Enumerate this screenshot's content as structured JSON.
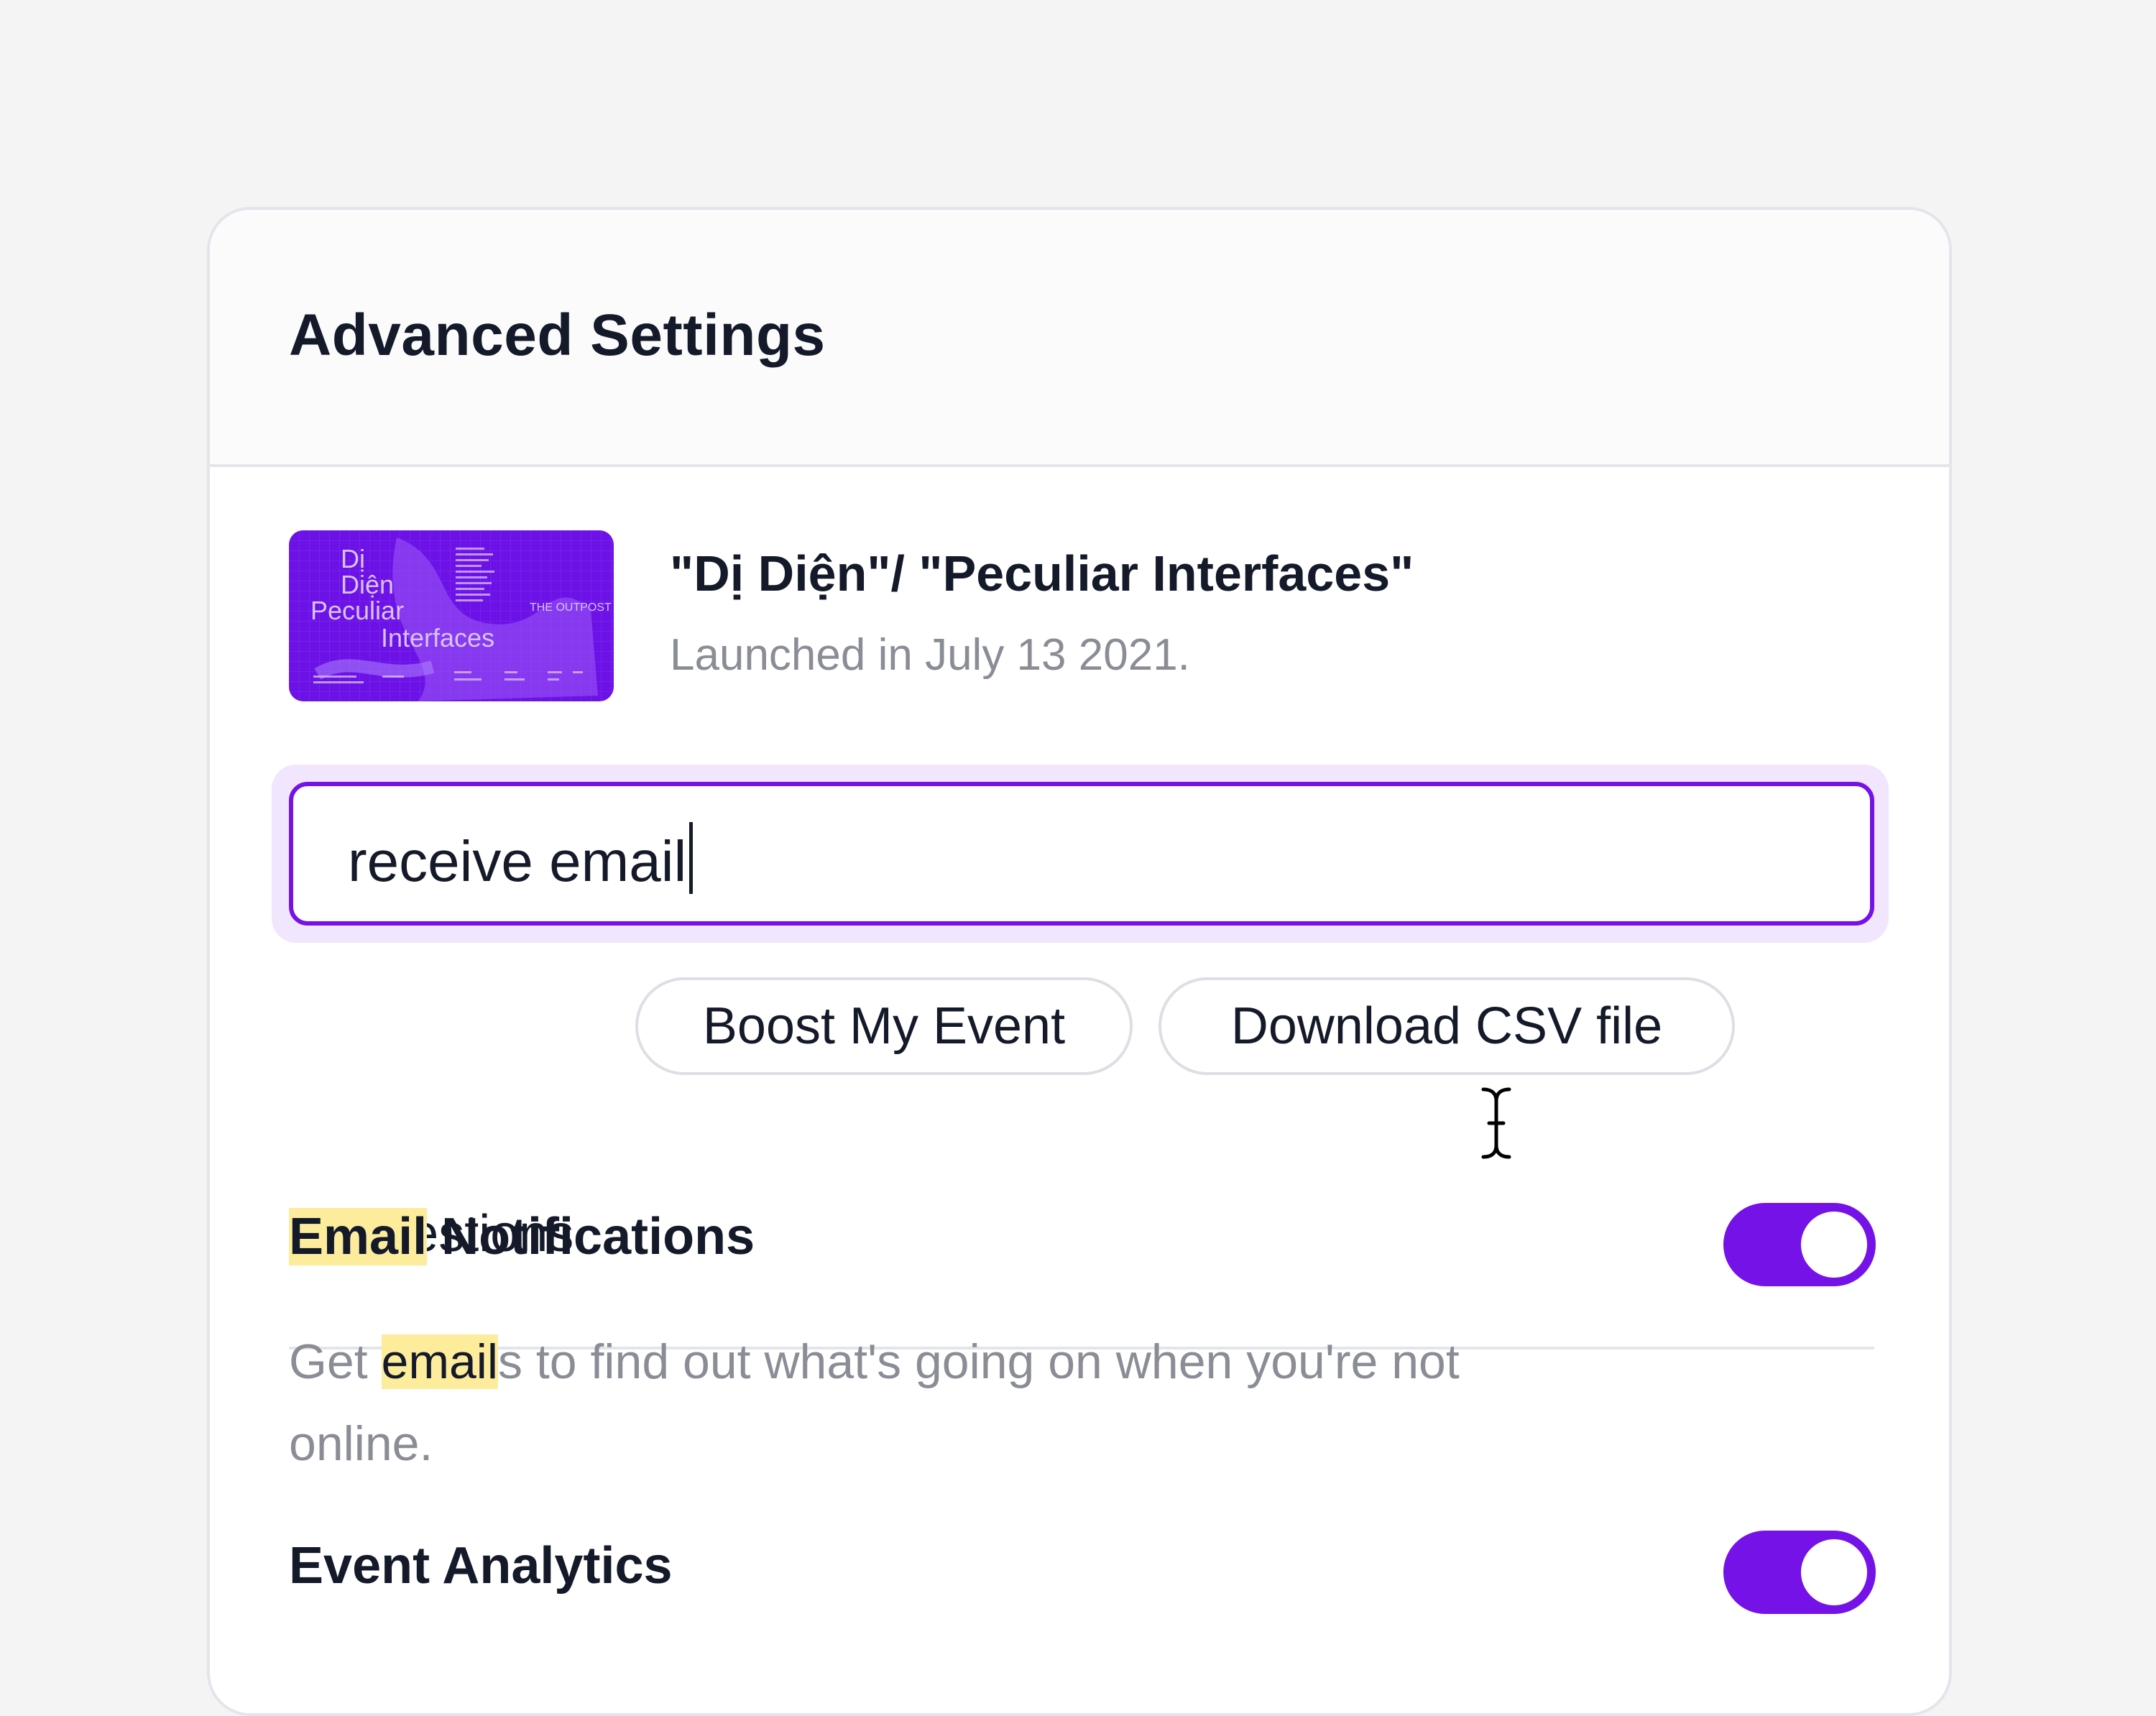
{
  "header": {
    "title": "Advanced Settings"
  },
  "event": {
    "title": "\"Dị Diện\"/ \"Peculiar Interfaces\"",
    "subtitle": "Launched in July 13 2021.",
    "thumbnail": {
      "line1": "Dị",
      "line2": "Diện",
      "line3": "Peculiar",
      "line4": "Interfaces",
      "venue": "THE OUTPOST"
    }
  },
  "search": {
    "value": "receive email"
  },
  "suggestions": {
    "label": "Suggestions",
    "items": [
      "Boost My Event",
      "Download CSV file"
    ]
  },
  "settings": [
    {
      "title_highlight": "Email",
      "title_rest": " Notifications",
      "desc_pre": "Get ",
      "desc_highlight": "email",
      "desc_post": "s to find out what's going on when you're not online.",
      "enabled": true
    },
    {
      "title": "Event Analytics",
      "enabled": true
    }
  ],
  "colors": {
    "accent": "#7412e8",
    "highlight": "#fcec9c",
    "muted_text": "#8a8d96",
    "text": "#141a29"
  }
}
